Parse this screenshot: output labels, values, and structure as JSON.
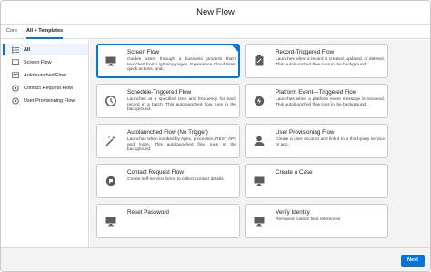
{
  "header": {
    "title": "New Flow"
  },
  "tabs": [
    {
      "label": "Core"
    },
    {
      "label": "All + Templates"
    }
  ],
  "sidebar": {
    "items": [
      {
        "label": "All",
        "icon": "list-icon",
        "active": true
      },
      {
        "label": "Screen Flow",
        "icon": "screen-icon"
      },
      {
        "label": "Autolaunched Flow",
        "icon": "autolaunch-icon"
      },
      {
        "label": "Contact Request Flow",
        "icon": "contact-request-icon"
      },
      {
        "label": "User Provisioning Flow",
        "icon": "user-provisioning-icon"
      }
    ]
  },
  "cards": [
    {
      "title": "Screen Flow",
      "desc": "Guides users through a business process that's launched from Lightning pages, Experience Cloud sites, quick actions, and...",
      "icon": "monitor-icon",
      "selected": true
    },
    {
      "title": "Record-Triggered Flow",
      "desc": "Launches when a record is created, updated, or deleted. This autolaunched flow runs in the background.",
      "icon": "record-trigger-icon"
    },
    {
      "title": "Schedule-Triggered Flow",
      "desc": "Launches at a specified time and frequency for each record in a batch. This autolaunched flow runs in the background.",
      "icon": "clock-icon"
    },
    {
      "title": "Platform Event—Triggered Flow",
      "desc": "Launches when a platform event message is received. This autolaunched flow runs in the background.",
      "icon": "platform-event-icon"
    },
    {
      "title": "Autolaunched Flow (No Trigger)",
      "desc": "Launches when invoked by Apex, processes, REST API, and more. This autolaunched flow runs in the background.",
      "icon": "magic-wand-icon"
    },
    {
      "title": "User Provisioning Flow",
      "desc": "Create a user account and link it to a third-party service or app.",
      "icon": "user-icon"
    },
    {
      "title": "Contact Request Flow",
      "desc": "Create self-service forms to collect contact details.",
      "icon": "contact-request-icon"
    },
    {
      "title": "Create a Case",
      "desc": "",
      "icon": "monitor-icon"
    },
    {
      "title": "Reset Password",
      "desc": "",
      "icon": "monitor-icon"
    },
    {
      "title": "Verify Identity",
      "desc": "Removed custom field references",
      "icon": "monitor-icon"
    }
  ],
  "footer": {
    "next_label": "Next"
  },
  "colors": {
    "accent": "#0176d3",
    "icon": "#5c5c5c",
    "content_bg": "#f3f3f3"
  }
}
